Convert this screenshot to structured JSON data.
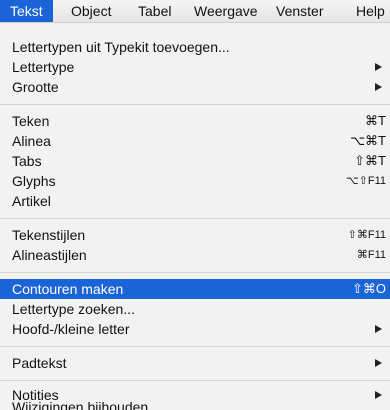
{
  "menubar": {
    "items": [
      "Tekst",
      "Object",
      "Tabel",
      "Weergave",
      "Venster",
      "Help"
    ]
  },
  "menu": {
    "items": [
      {
        "label": "Lettertypen uit Typekit toevoegen..."
      },
      {
        "label": "Lettertype",
        "arrow": true
      },
      {
        "label": "Grootte",
        "arrow": true
      },
      {
        "label": "Teken",
        "shortcut": "⌘T"
      },
      {
        "label": "Alinea",
        "shortcut": "⌥⌘T"
      },
      {
        "label": "Tabs",
        "shortcut": "⇧⌘T"
      },
      {
        "label": "Glyphs",
        "shortcut": "⌥⇧F11"
      },
      {
        "label": "Artikel"
      },
      {
        "label": "Tekenstijlen",
        "shortcut": "⇧⌘F11"
      },
      {
        "label": "Alineastijlen",
        "shortcut": "⌘F11"
      },
      {
        "label": "Contouren maken",
        "shortcut": "⇧⌘O",
        "highlighted": true
      },
      {
        "label": "Lettertype zoeken..."
      },
      {
        "label": "Hoofd-/kleine letter",
        "arrow": true
      },
      {
        "label": "Padtekst",
        "arrow": true
      },
      {
        "label": "Notities",
        "arrow": true
      }
    ],
    "partial_label": "Wijzigingen bijhouden"
  },
  "colors": {
    "highlight": "#1b64d8",
    "menu_bg": "#f2f2f2"
  }
}
